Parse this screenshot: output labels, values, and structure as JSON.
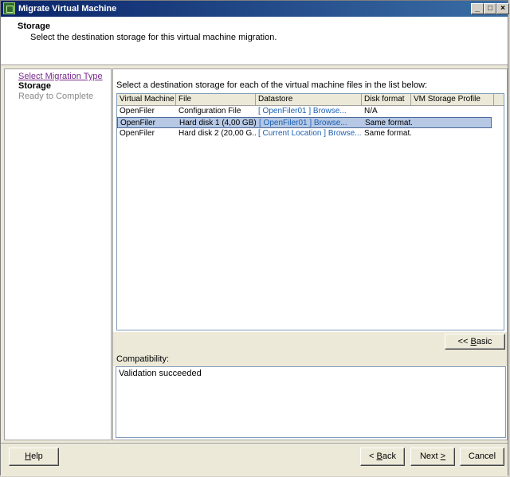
{
  "window": {
    "title": "Migrate Virtual Machine"
  },
  "header": {
    "title": "Storage",
    "subtitle": "Select the destination storage for this virtual machine migration."
  },
  "nav": {
    "items": [
      {
        "label": "Select Migration Type",
        "state": "link"
      },
      {
        "label": "Storage",
        "state": "current"
      },
      {
        "label": "Ready to Complete",
        "state": "disabled"
      }
    ]
  },
  "main": {
    "instruction": "Select a destination storage for each of the virtual machine files in the list below:",
    "columns": [
      "Virtual Machine",
      "File",
      "Datastore",
      "Disk format",
      "VM Storage Profile"
    ],
    "rows": [
      {
        "vm": "OpenFiler",
        "file": "Configuration File",
        "datastore": "[ OpenFiler01 ] Browse...",
        "format": "N/A",
        "profile": ""
      },
      {
        "vm": "OpenFiler",
        "file": "Hard disk 1 (4,00 GB)",
        "datastore": "[ OpenFiler01 ] Browse...",
        "format": "Same format...",
        "profile": ""
      },
      {
        "vm": "OpenFiler",
        "file": "Hard disk 2 (20,00 G...",
        "datastore": "[ Current Location ] Browse...",
        "format": "Same format...",
        "profile": ""
      }
    ],
    "basic_button": {
      "pre": "<< ",
      "accel": "B",
      "rest": "asic"
    },
    "compat_label": "Compatibility:",
    "compat_text": "Validation succeeded"
  },
  "footer": {
    "help": {
      "accel": "H",
      "rest": "elp"
    },
    "back": {
      "pre": "< ",
      "accel": "B",
      "rest": "ack"
    },
    "next": {
      "pre": "Next ",
      "accel": ">",
      "rest": ""
    },
    "cancel": "Cancel"
  }
}
